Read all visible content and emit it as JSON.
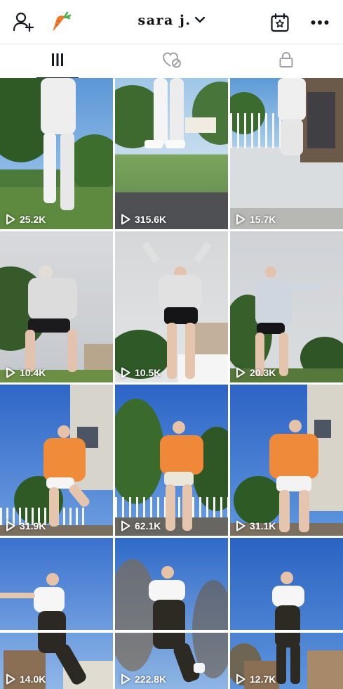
{
  "header": {
    "username": "sara j.",
    "icons": {
      "add_friend": "add-user-icon",
      "carrot": "carrot-icon",
      "dropdown": "chevron-down-icon",
      "calendar": "calendar-star-icon",
      "more": "more-icon"
    }
  },
  "tabs": [
    {
      "icon": "grid-icon",
      "active": true
    },
    {
      "icon": "liked-hidden-icon",
      "active": false
    },
    {
      "icon": "lock-icon",
      "active": false
    }
  ],
  "videos": [
    {
      "views": "25.2K"
    },
    {
      "views": "315.6K"
    },
    {
      "views": "15.7K"
    },
    {
      "views": "10.4K"
    },
    {
      "views": "10.5K"
    },
    {
      "views": "20.3K"
    },
    {
      "views": "31.9K"
    },
    {
      "views": "62.1K"
    },
    {
      "views": "31.1K"
    },
    {
      "views": "14.0K"
    },
    {
      "views": "222.8K"
    },
    {
      "views": "12.7K"
    }
  ],
  "colors": {
    "accent": "#161823",
    "carrot_orange": "#f07a2b",
    "carrot_green": "#4caf50"
  }
}
